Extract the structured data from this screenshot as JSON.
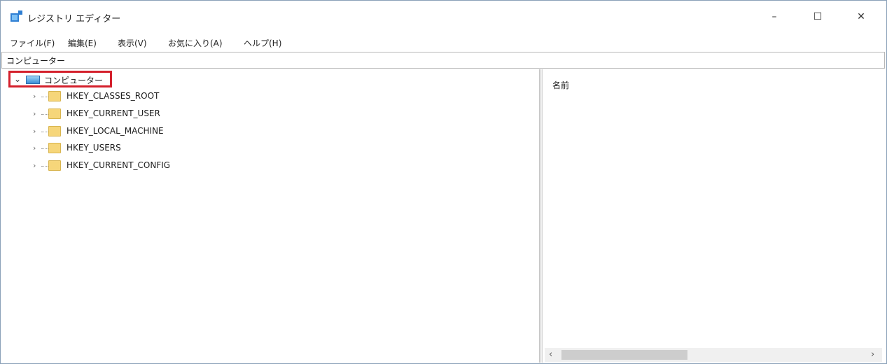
{
  "window": {
    "title": "レジストリ エディター",
    "controls": {
      "minimize": "–",
      "maximize": "☐",
      "close": "✕"
    }
  },
  "menu": [
    "ファイル(F)",
    "編集(E)",
    "表示(V)",
    "お気に入り(A)",
    "ヘルプ(H)"
  ],
  "address": "コンピューター",
  "tree": {
    "root": {
      "label": "コンピューター",
      "expanded": true,
      "icon": "computer-icon"
    },
    "children": [
      {
        "label": "HKEY_CLASSES_ROOT"
      },
      {
        "label": "HKEY_CURRENT_USER"
      },
      {
        "label": "HKEY_LOCAL_MACHINE"
      },
      {
        "label": "HKEY_USERS"
      },
      {
        "label": "HKEY_CURRENT_CONFIG"
      }
    ]
  },
  "list": {
    "column_name": "名前"
  },
  "colors": {
    "highlight": "#d4202c",
    "folder": "#f6d67a"
  }
}
